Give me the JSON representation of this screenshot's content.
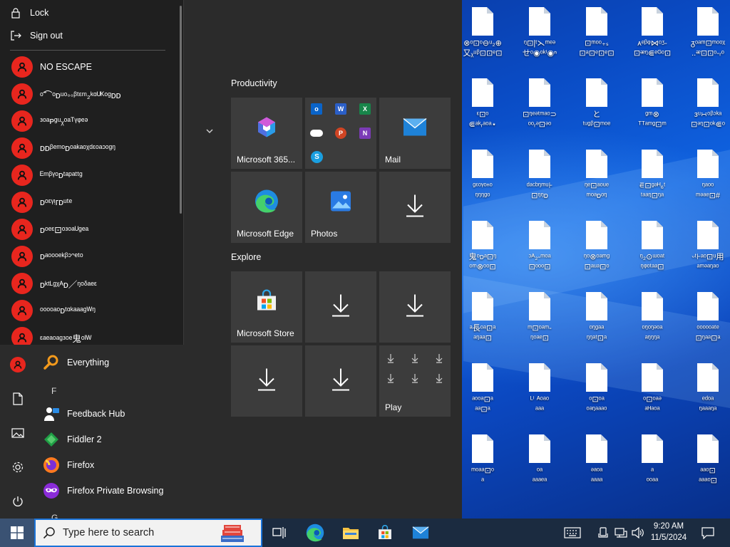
{
  "desktop": {
    "icons": [
      {
        "label": "ᵤⁿᵩ₶ɷ♡\n⊦-⋐⊦⊈ʘ/"
      },
      {
        "label": "ᵒ̃ᵝᵃ⌐ᵒᵝ♡\n⋍ᵕ⊏ᵑ/ᴿᵧ⊡"
      },
      {
        "label": "ᵗᵚ∧●ᴅᵤⁿ₂\nᴅ⋍ᵥᵒ●ᵒ₂ᵒ"
      },
      {
        "label": "ᵣᵒᵪᵡ⑊⊡ᵀᵶ\n⊡ᵃ₍ᵒᵣ₍⊡"
      },
      {
        "label": "刀⍵ᵒ⊡ᵝ▼.\nᵃᵒ₂⊡⊡"
      },
      {
        "label": "⊗ᵒ⊡ᵒ⊖ᵘ₂⊕\n又ᵪᵘᵝ⊡⊡ᵉ⊡"
      },
      {
        "label": "ᵑ⊡|ᵗ⋋ᵐᵉᵊ\nせᵒ◉ᵒᵏⁱ◉ⁿ"
      },
      {
        "label": "⊡ᵐᵒᵒ₊ₛ\n⊡ᵃ⊡ᵉ⊡ᵉ⊡"
      },
      {
        "label": "ᴀᵉᵝᵠ⋈ᵒᶾ-\n⊡ᵆᵑ⋐ᵉᴳᵒ⊡"
      },
      {
        "label": "ᵹᵒᵃᵐ⊡ᵐᵒᵒᵡ\n..ᵆ⊡⊡ᵒ-ᵣᵒ"
      },
      {
        "label": "ᵋ⊡ᵒ\n⋐ᵃᵏᵣᵃᵒᵃ⋆"
      },
      {
        "label": "⊡ᵑᵉᵊᵗᵐᵃᵒ⊃\nᵒᵒᵣᵊ⊡ᵊᵒ"
      },
      {
        "label": "と\nᵗᵘᵍᵝ⊡ᵐᵒᵉ"
      },
      {
        "label": "ᵍᵐ⊗\nᵀᵀᵃᵐᵍ⊡ᵐ"
      },
      {
        "label": "ᴈᵘ∺ᵒᵝᵓᵏᵃ\n⊡ᵊᵑ⊡ᵒᵏ⋐ᵒ"
      },
      {
        "label": "ᵍᵋᵒᵞᵒⁿᵒ\nᵑᵑᵑᵍᵒ"
      },
      {
        "label": "ᵈᵃᶜᵇᵑᵐᵘ⊦\n⊡ᵑᵑᴅ"
      },
      {
        "label": "ᵑᵉ⊡ᵃᵒᵘᵉ\nᵐᵒᵃᴅᵒᵑ"
      },
      {
        "label": "⋷⊡ᵍᵊᴴ₆ᵗ\nᵗᵃᵃᵑ⊡ᵑᵃ"
      },
      {
        "label": "ᵑᵃᵒᵒ\nᵐᵊᵃᵉ⊡#"
      },
      {
        "label": "鬼ᵒᴅᵃ⊡ᵑ\nᵒᵐ⊗ᵒᵒ⊡"
      },
      {
        "label": "ᵓᴬ₂-ᵐᵒᵃ\n⊡ᵒᵒᵒ⊡"
      },
      {
        "label": "ᵑᵒ⊗ᵒᵃᵐᵍ\n⊡ᵃᵘᵃ⊡ᵒ"
      },
      {
        "label": "ᵑ₂⊙ᵚᵒᵃᵗ\nᵑᵠᵒᵗᵃᵃ⊡"
      },
      {
        "label": "ᵕᵗ⊦ᵃᵒ⊡ᵘ用\nᵃᵐᵊᵃᵑᵃᵒ"
      },
      {
        "label": "ᵃ長ᵒᵃ⊡ᵃ\nᵃᵑᵃᵃ⊡"
      },
      {
        "label": "ᵐ⊡ᵒᵃᵐ-\nᵑᵒᵃᵉ⊡"
      },
      {
        "label": "ᵒᵑᵍᵃᵃ\nᵑᵑᵃᵗ⊡ᵃ"
      },
      {
        "label": "ᵒᵑᵒᵑᵊᵒᵃ\nᵃᵑᵑᵑᵃ"
      },
      {
        "label": "ᵒᵒᵒᵒᵒᵃᵗᵉ\n⊡ᵑᵃᵃ⊡ᵃ"
      },
      {
        "label": "ᵃᵒᵒᵃ⊡ᵃ\nᵃᵃ⊡ᵃ"
      },
      {
        "label": "ᴸⁱ ᴬᵒᵃᵒ\nᵃᵃᵃ"
      },
      {
        "label": "ᵒ⊡ᵒᵃ\nᵒᵃᵑᵃᵃᵃᵒ"
      },
      {
        "label": "ᵒ⊡ᵒᵃᵊ\nᵃᴴᵃᵒᵃ"
      },
      {
        "label": "ᵉᵈᵒᵃ\nᵑᵃᵃᵃᵑᵃ"
      },
      {
        "label": "ᵐᵒᵃᵃ⊡ᵒ\nᵃ"
      },
      {
        "label": "ᵒᵃ\nᵃᵃᵃᵉᵃ"
      },
      {
        "label": "ᵊᵃᵒᵃ\nᵃᵃᵃᵃ"
      },
      {
        "label": "ᵃ\nᵒᵒᵃᵃ"
      },
      {
        "label": "ᵃᵃᵒ⊡\nᵃᵃᵃᵒ⊡"
      }
    ]
  },
  "start_menu": {
    "power_popup": {
      "lock_label": "Lock",
      "signout_label": "Sign out",
      "users": [
        {
          "name": "NO ESCAPE"
        },
        {
          "name": "ᵒ̃⌒ᵒᴅᵘᵒ◦◦ᵝᵗᵋᵐ₂ᵏᵅᵁᴷᵒᵍᴅᴅ"
        },
        {
          "name": "ᵌᵒᵃᴘᵍᵘᵪᵒᵃᵀᵞᵠᵉᵊ"
        },
        {
          "name": "ᴅᴅᵝᵉᵐᵒᴅᵒᵃᵏᵃᵒᵡᵈᵋᵒᵃᵓᵒᵍᵑ"
        },
        {
          "name": "ᴱᵐᵝᵞᵒᴅᵗᵃᵖᵃᵗᵗᵍ"
        },
        {
          "name": "ᴅᵒᵋᵞᵎᴦᴅᵘᵗᵉ"
        },
        {
          "name": "ᴅᵒᵉᵋ⊡ᵒᵌᵒᵃᵁᵍᵉᵃ"
        },
        {
          "name": "ᴅᵃᵒᵒᵒᵉᵏᵝᵓᵔᵉᵗᵒ"
        },
        {
          "name": "ᴅᵏᵗᴸᵍᵡᴬᴅ／ᵑᵒᵟᵃᵉᵋ"
        },
        {
          "name": "ᵒᵒᵒᵒᵃᵒᴅᵗᵅᵏᵃᵃᵃᵍᵂᵑ"
        },
        {
          "name": "ᵋᵃᵉᵃᵒᵃᵍᵌᵒᵉ鬼ᵒᴵᵂ"
        }
      ]
    },
    "app_list": {
      "everything": "Everything",
      "letter_f": "F",
      "feedback_hub": "Feedback Hub",
      "fiddler": "Fiddler 2",
      "firefox": "Firefox",
      "firefox_private": "Firefox Private Browsing",
      "letter_g": "G"
    },
    "groups": {
      "productivity": "Productivity",
      "explore": "Explore"
    },
    "tiles": {
      "m365": "Microsoft 365...",
      "mail": "Mail",
      "edge": "Microsoft Edge",
      "photos": "Photos",
      "store": "Microsoft Store",
      "play": "Play"
    }
  },
  "taskbar": {
    "search_placeholder": "Type here to search",
    "time": "9:20 AM",
    "date": "11/5/2024"
  },
  "colors": {
    "accent": "#1a73d9",
    "avatar_red": "#e8261e",
    "tile_bg": "#3c3c3c",
    "start_bg": "#2b2b2b"
  }
}
